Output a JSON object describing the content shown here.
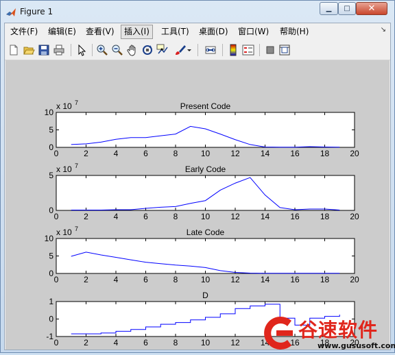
{
  "window": {
    "title": "Figure 1",
    "min_glyph": "▁",
    "max_glyph": "□",
    "close_glyph": "✕"
  },
  "menubar": {
    "items": [
      "文件(F)",
      "编辑(E)",
      "查看(V)",
      "插入(I)",
      "工具(T)",
      "桌面(D)",
      "窗口(W)",
      "帮助(H)"
    ],
    "active_index": 3,
    "overflow_glyph": "↘"
  },
  "toolbar": {
    "buttons": [
      "new-figure-icon",
      "open-file-icon",
      "save-icon",
      "print-icon",
      "pointer-icon",
      "zoom-in-icon",
      "zoom-out-icon",
      "pan-hand-icon",
      "rotate-3d-icon",
      "data-cursor-icon",
      "brush-icon",
      "brush-dropdown-icon",
      "link-plot-icon",
      "colorbar-icon",
      "legend-icon",
      "hide-plot-tools-icon",
      "show-plot-tools-icon"
    ]
  },
  "chart_data": [
    {
      "type": "line",
      "title": "Present Code",
      "exponent_label": "x 10",
      "exponent_power": "7",
      "xlim": [
        0,
        20
      ],
      "ylim": [
        0,
        10
      ],
      "x_ticks": [
        "0",
        "2",
        "4",
        "6",
        "8",
        "10",
        "12",
        "14",
        "16",
        "18",
        "20"
      ],
      "y_ticks": [
        "0",
        "5",
        "10"
      ],
      "x": [
        1,
        2,
        3,
        4,
        5,
        6,
        7,
        8,
        9,
        10,
        11,
        12,
        13,
        14,
        15,
        16,
        17,
        18,
        19
      ],
      "y": [
        0.8,
        1.0,
        1.5,
        2.3,
        2.8,
        2.8,
        3.3,
        3.8,
        6.0,
        5.3,
        3.8,
        2.2,
        0.8,
        0.1,
        0.05,
        0.05,
        0.2,
        0.1,
        0.05
      ],
      "color": "#0000ff"
    },
    {
      "type": "line",
      "title": "Early Code",
      "exponent_label": "x 10",
      "exponent_power": "7",
      "xlim": [
        0,
        20
      ],
      "ylim": [
        0,
        5
      ],
      "x_ticks": [
        "0",
        "2",
        "4",
        "6",
        "8",
        "10",
        "12",
        "14",
        "16",
        "18",
        "20"
      ],
      "y_ticks": [
        "0",
        "5"
      ],
      "x": [
        1,
        2,
        3,
        4,
        5,
        6,
        7,
        8,
        9,
        10,
        11,
        12,
        13,
        14,
        15,
        16,
        17,
        18,
        19
      ],
      "y": [
        0.05,
        0.05,
        0.05,
        0.1,
        0.1,
        0.3,
        0.45,
        0.55,
        1.0,
        1.4,
        2.9,
        3.9,
        4.7,
        2.2,
        0.4,
        0.1,
        0.2,
        0.2,
        0.05
      ],
      "color": "#0000ff"
    },
    {
      "type": "line",
      "title": "Late Code",
      "exponent_label": "x 10",
      "exponent_power": "7",
      "xlim": [
        0,
        20
      ],
      "ylim": [
        0,
        10
      ],
      "x_ticks": [
        "0",
        "2",
        "4",
        "6",
        "8",
        "10",
        "12",
        "14",
        "16",
        "18",
        "20"
      ],
      "y_ticks": [
        "0",
        "5",
        "10"
      ],
      "x": [
        1,
        2,
        3,
        4,
        5,
        6,
        7,
        8,
        9,
        10,
        11,
        12,
        13,
        14,
        15,
        16,
        17,
        18,
        19
      ],
      "y": [
        4.9,
        6.1,
        5.3,
        4.6,
        3.9,
        3.2,
        2.8,
        2.4,
        2.1,
        1.7,
        0.8,
        0.3,
        0.1,
        0.05,
        0.05,
        0.05,
        0.05,
        0.05,
        0.05
      ],
      "color": "#0000ff"
    },
    {
      "type": "line",
      "title": "D",
      "step": true,
      "xlim": [
        0,
        20
      ],
      "ylim": [
        -1,
        1
      ],
      "x_ticks": [
        "0",
        "2",
        "4",
        "6",
        "8",
        "10",
        "12",
        "14",
        "16",
        "18",
        "20"
      ],
      "y_ticks": [
        "-1",
        "0",
        "1"
      ],
      "x": [
        1,
        2,
        3,
        4,
        5,
        6,
        7,
        8,
        9,
        10,
        11,
        12,
        13,
        14,
        15,
        16,
        17,
        18,
        19
      ],
      "y": [
        -0.85,
        -0.85,
        -0.8,
        -0.7,
        -0.6,
        -0.45,
        -0.3,
        -0.2,
        -0.05,
        0.1,
        0.3,
        0.6,
        0.75,
        0.85,
        0.05,
        -0.35,
        0.05,
        0.15,
        0.25
      ],
      "color": "#0000ff"
    }
  ],
  "watermark": {
    "name": "谷速软件",
    "url": "www.gususoft.com"
  }
}
